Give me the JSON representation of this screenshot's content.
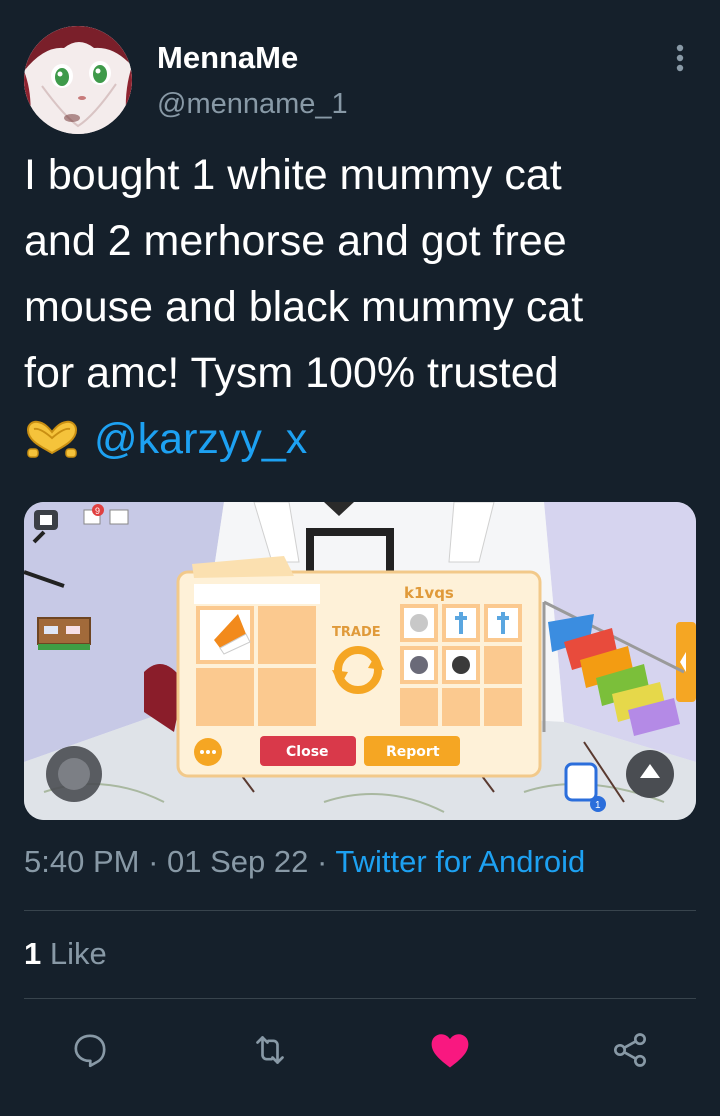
{
  "tweet": {
    "display_name": "MennaMe",
    "handle": "@menname_1",
    "text_lines": [
      "I bought 1 white mummy cat",
      "and 2 merhorse and got free",
      "mouse and black mummy cat",
      "for amc! Tysm 100% trusted"
    ],
    "mention": "@karzyy_x",
    "time": "5:40 PM",
    "sep1": " · ",
    "date": "01 Sep 22",
    "sep2": " · ",
    "source": "Twitter for Android",
    "like_count": "1",
    "like_label": " Like"
  },
  "media": {
    "trade_player": "k1vqs",
    "trade_label": "TRADE",
    "close_label": "Close",
    "report_label": "Report",
    "notif_count": "1",
    "chat_badge": "9"
  },
  "icons": {
    "more": "more-vertical-icon",
    "reply": "reply-icon",
    "retweet": "retweet-icon",
    "like": "heart-filled-icon",
    "share": "share-icon",
    "emoji": "heart-hands-emoji"
  },
  "colors": {
    "background": "#15202b",
    "secondary_text": "#8899a6",
    "link": "#1da1f2",
    "liked": "#f91880",
    "divider": "#38444d"
  }
}
